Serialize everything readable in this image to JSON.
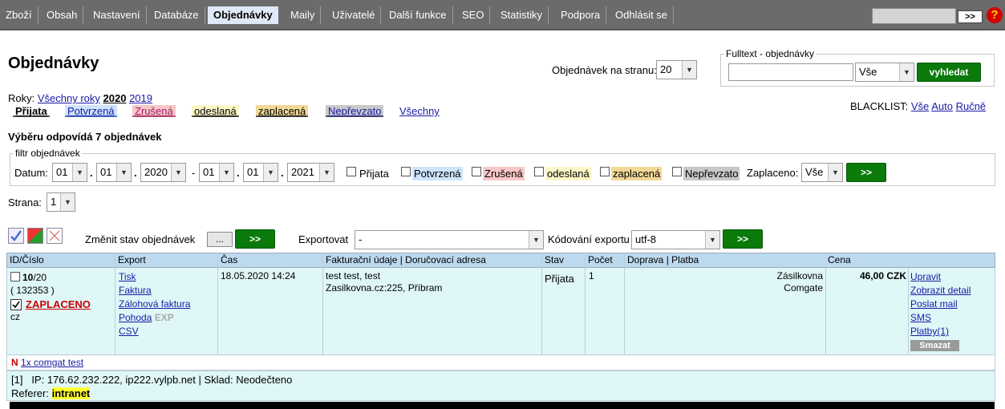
{
  "nav": {
    "items": [
      "Zboží",
      "Obsah",
      "Nastavení",
      "Databáze",
      "Objednávky",
      "Maily",
      "Uživatelé",
      "Další funkce",
      "SEO",
      "Statistiky",
      "Podpora",
      "Odhlásit se"
    ],
    "active": "Objednávky",
    "go_label": ">>",
    "help": "?"
  },
  "page": {
    "title": "Objednávky",
    "per_page_label": "Objednávek na stranu:",
    "per_page_value": "20"
  },
  "fulltext": {
    "legend": "Fulltext - objednávky",
    "scope": "Vše",
    "button": "vyhledat"
  },
  "years": {
    "label": "Roky:",
    "all": "Všechny roky",
    "current": "2020",
    "other": "2019"
  },
  "statuses": {
    "prijata": "Přijata",
    "potvrzena": "Potvrzená",
    "zrusena": "Zrušená",
    "odeslana": "odeslaná",
    "zaplacena": "zaplacená",
    "neprevzato": "Nepřevzato",
    "vsechny": "Všechny"
  },
  "blacklist": {
    "label": "BLACKLIST:",
    "all": "Vše",
    "auto": "Auto",
    "manual": "Ručně"
  },
  "summary": "Výběru odpovídá 7 objednávek",
  "filter": {
    "legend": "filtr objednávek",
    "date_label": "Datum:",
    "from_day": "01",
    "from_month": "01",
    "from_year": "2020",
    "dash": "-",
    "dot": ".",
    "to_day": "01",
    "to_month": "01",
    "to_year": "2021",
    "paid_label": "Zaplaceno:",
    "paid_value": "Vše",
    "go": ">>"
  },
  "pager": {
    "label": "Strana:",
    "value": "1"
  },
  "actions": {
    "change_status_label": "Změnit stav objednávek",
    "dots": "...",
    "go": ">>",
    "export_label": "Exportovat",
    "export_value": "-",
    "encoding_label": "Kódování exportu",
    "encoding_value": "utf-8"
  },
  "table": {
    "headers": [
      "ID/Číslo",
      "Export",
      "Čas",
      "Fakturační údaje | Doručovací adresa",
      "Stav",
      "Počet",
      "Doprava | Platba",
      "Cena"
    ],
    "row": {
      "id": "10",
      "id_suffix": "/20",
      "number": "( 132353 )",
      "paid": "ZAPLACENO",
      "lang": "cz",
      "export_links": [
        "Tisk",
        "Faktura",
        "Zálohová faktura",
        "Pohoda",
        "CSV"
      ],
      "exp": "EXP",
      "time": "18.05.2020 14:24",
      "billing_name": "test test, test",
      "delivery": "Zasilkovna.cz:225, Příbram",
      "status": "Přijata",
      "count": "1",
      "shipping": "Zásilkovna",
      "payment": "Comgate",
      "price": "46,00 CZK",
      "row_actions": [
        "Upravit",
        "Zobrazit detail",
        "Poslat mail",
        "SMS",
        "Platby(1)"
      ],
      "delete": "Smazat"
    },
    "item": {
      "flag": "N",
      "text": "1x comgat test"
    },
    "info": {
      "index": "[1]",
      "ip": "IP: 176.62.232.222, ip222.vylpb.net | Sklad: Neodečteno",
      "referer_label": "Referer:",
      "referer": "intranet"
    }
  },
  "colors": {
    "nav_bg": "#6b6b6b",
    "accent_green": "#0a7a0a",
    "header_blue": "#bcd9ee",
    "row_cyan": "#dff7f7",
    "paid_red": "#cc0000",
    "referer_yellow": "#ffff33"
  }
}
